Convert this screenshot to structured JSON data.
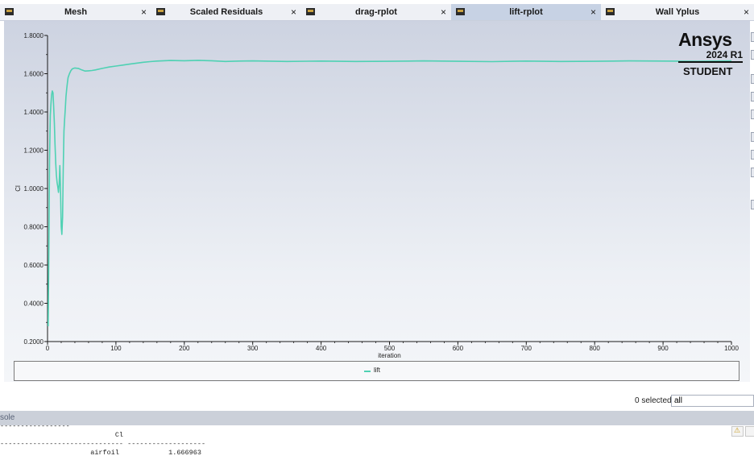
{
  "tabs": [
    {
      "label": "Mesh",
      "active": false,
      "icon": "window-icon"
    },
    {
      "label": "Scaled Residuals",
      "active": false,
      "icon": "window-icon"
    },
    {
      "label": "drag-rplot",
      "active": false,
      "icon": "window-icon"
    },
    {
      "label": "lift-rplot",
      "active": true,
      "icon": "window-icon"
    },
    {
      "label": "Wall Yplus",
      "active": false,
      "icon": "window-icon"
    }
  ],
  "tab_close_glyph": "×",
  "logo": {
    "name": "Ansys",
    "version": "2024 R1",
    "edition": "STUDENT"
  },
  "chart_data": {
    "type": "line",
    "xlabel": "iteration",
    "ylabel": "Cl",
    "xlim": [
      0,
      1000
    ],
    "ylim": [
      0.2,
      1.8
    ],
    "x_ticks": [
      "0",
      "100",
      "200",
      "300",
      "400",
      "500",
      "600",
      "700",
      "800",
      "900",
      "1000"
    ],
    "y_ticks": [
      "0.2000",
      "0.4000",
      "0.6000",
      "0.8000",
      "1.0000",
      "1.2000",
      "1.4000",
      "1.6000",
      "1.8000"
    ],
    "grid": false,
    "legend": "bottom",
    "series": [
      {
        "name": "lift",
        "color": "#4fd1b3",
        "x": [
          1,
          2,
          3,
          4,
          5,
          6,
          7,
          8,
          9,
          10,
          11,
          12,
          13,
          14,
          15,
          16,
          17,
          18,
          19,
          20,
          21,
          22,
          23,
          24,
          25,
          26,
          27,
          28,
          29,
          30,
          32,
          34,
          36,
          38,
          40,
          45,
          50,
          55,
          60,
          65,
          70,
          80,
          90,
          100,
          110,
          120,
          130,
          140,
          150,
          160,
          170,
          180,
          200,
          220,
          240,
          260,
          280,
          300,
          350,
          400,
          450,
          500,
          550,
          600,
          650,
          700,
          750,
          800,
          850,
          900,
          950,
          1000
        ],
        "y": [
          0.28,
          0.7,
          1.15,
          1.38,
          1.44,
          1.49,
          1.51,
          1.5,
          1.43,
          1.34,
          1.23,
          1.13,
          1.07,
          1.03,
          1.01,
          0.98,
          1.02,
          1.12,
          1.0,
          0.8,
          0.76,
          0.85,
          1.1,
          1.3,
          1.36,
          1.42,
          1.48,
          1.52,
          1.55,
          1.58,
          1.6,
          1.615,
          1.625,
          1.628,
          1.63,
          1.628,
          1.62,
          1.614,
          1.615,
          1.617,
          1.62,
          1.628,
          1.635,
          1.64,
          1.645,
          1.65,
          1.655,
          1.66,
          1.663,
          1.666,
          1.668,
          1.669,
          1.668,
          1.67,
          1.668,
          1.664,
          1.666,
          1.667,
          1.664,
          1.666,
          1.664,
          1.665,
          1.667,
          1.665,
          1.663,
          1.666,
          1.664,
          1.665,
          1.667,
          1.666,
          1.665,
          1.667
        ]
      }
    ]
  },
  "selection": {
    "count_text": "0 selected",
    "filter_value": "all"
  },
  "console": {
    "title": "sole",
    "lines": [
      "-----------------",
      "                            Cl",
      "------------------------------ -------------------",
      "                      airfoil            1.666963"
    ]
  }
}
